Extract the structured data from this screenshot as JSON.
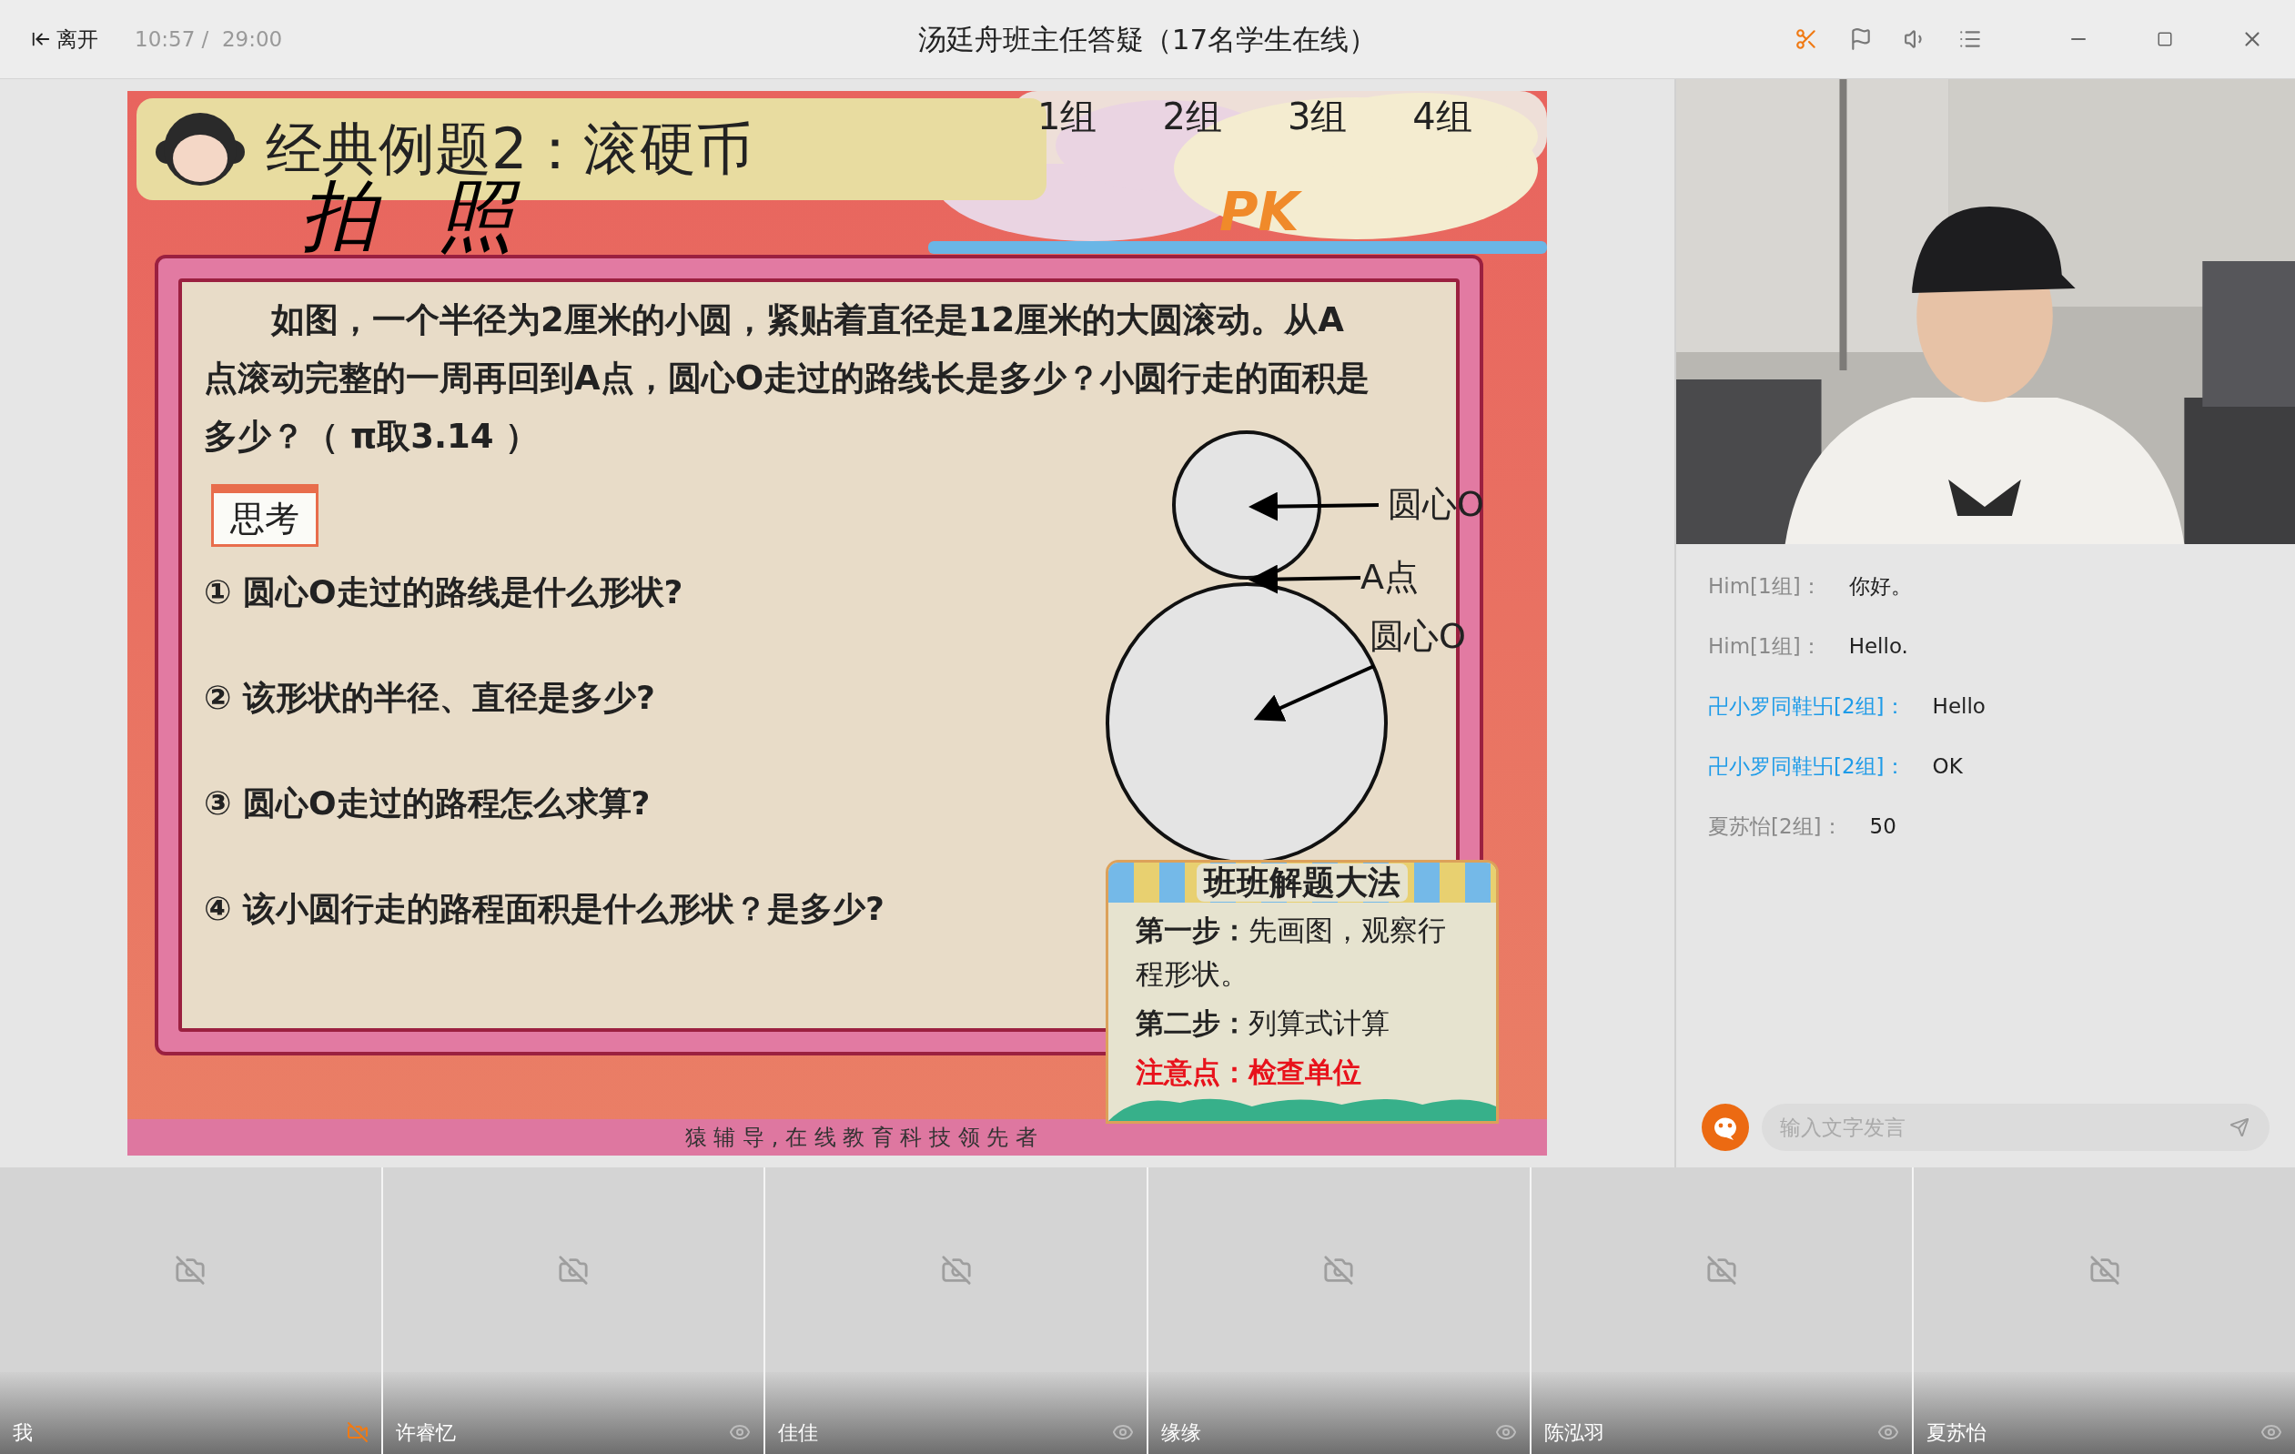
{
  "toolbar": {
    "leave": "离开",
    "time": "10:57 /  29:00",
    "title": "汤廷舟班主任答疑（17名学生在线）"
  },
  "slide": {
    "title": "经典例题2：滚硬币",
    "handwriting": "拍 照",
    "groups": [
      "1组",
      "2组",
      "3组",
      "4组"
    ],
    "pk": "PK",
    "problem": "如图，一个半径为2厘米的小圆，紧贴着直径是12厘米的大圆滚动。从A点滚动完整的一周再回到A点，圆心O走过的路线长是多少？小圆行走的面积是多少？（ π取3.14 ）",
    "think_label": "思考",
    "questions": [
      "① 圆心O走过的路线是什么形状?",
      "② 该形状的半径、直径是多少?",
      "③ 圆心O走过的路程怎么求算?",
      "④ 该小圆行走的路程面积是什么形状？是多少?"
    ],
    "diagram_labels": [
      "圆心O",
      "A点",
      "圆心O"
    ],
    "method": {
      "title": "班班解题大法",
      "steps": [
        {
          "kind": "step",
          "label": "第一步：",
          "text": "先画图，观察行程形状。"
        },
        {
          "kind": "step",
          "label": "第二步：",
          "text": "列算式计算"
        },
        {
          "kind": "warning",
          "label": "注意点：",
          "text": "检查单位"
        }
      ]
    },
    "footer": "猿 辅 导 , 在 线 教 育 科 技 领 先 者"
  },
  "chat": {
    "messages": [
      {
        "sender": "Him[1组]：",
        "text": "你好。",
        "color": "#8a8a8a"
      },
      {
        "sender": "Him[1组]：",
        "text": "Hello.",
        "color": "#8a8a8a"
      },
      {
        "sender": "卍小罗同鞋卐[2组]：",
        "text": "Hello",
        "color": "#1e9be8"
      },
      {
        "sender": "卍小罗同鞋卐[2组]：",
        "text": "OK",
        "color": "#1e9be8"
      },
      {
        "sender": "夏苏怡[2组]：",
        "text": "50",
        "color": "#8a8a8a"
      }
    ],
    "placeholder": "输入文字发言"
  },
  "students": [
    {
      "name": "我",
      "kind": "self"
    },
    {
      "name": "许睿忆",
      "kind": "peer"
    },
    {
      "name": "佳佳",
      "kind": "peer"
    },
    {
      "name": "缘缘",
      "kind": "peer"
    },
    {
      "name": "陈泓羽",
      "kind": "peer"
    },
    {
      "name": "夏苏怡",
      "kind": "peer"
    }
  ]
}
